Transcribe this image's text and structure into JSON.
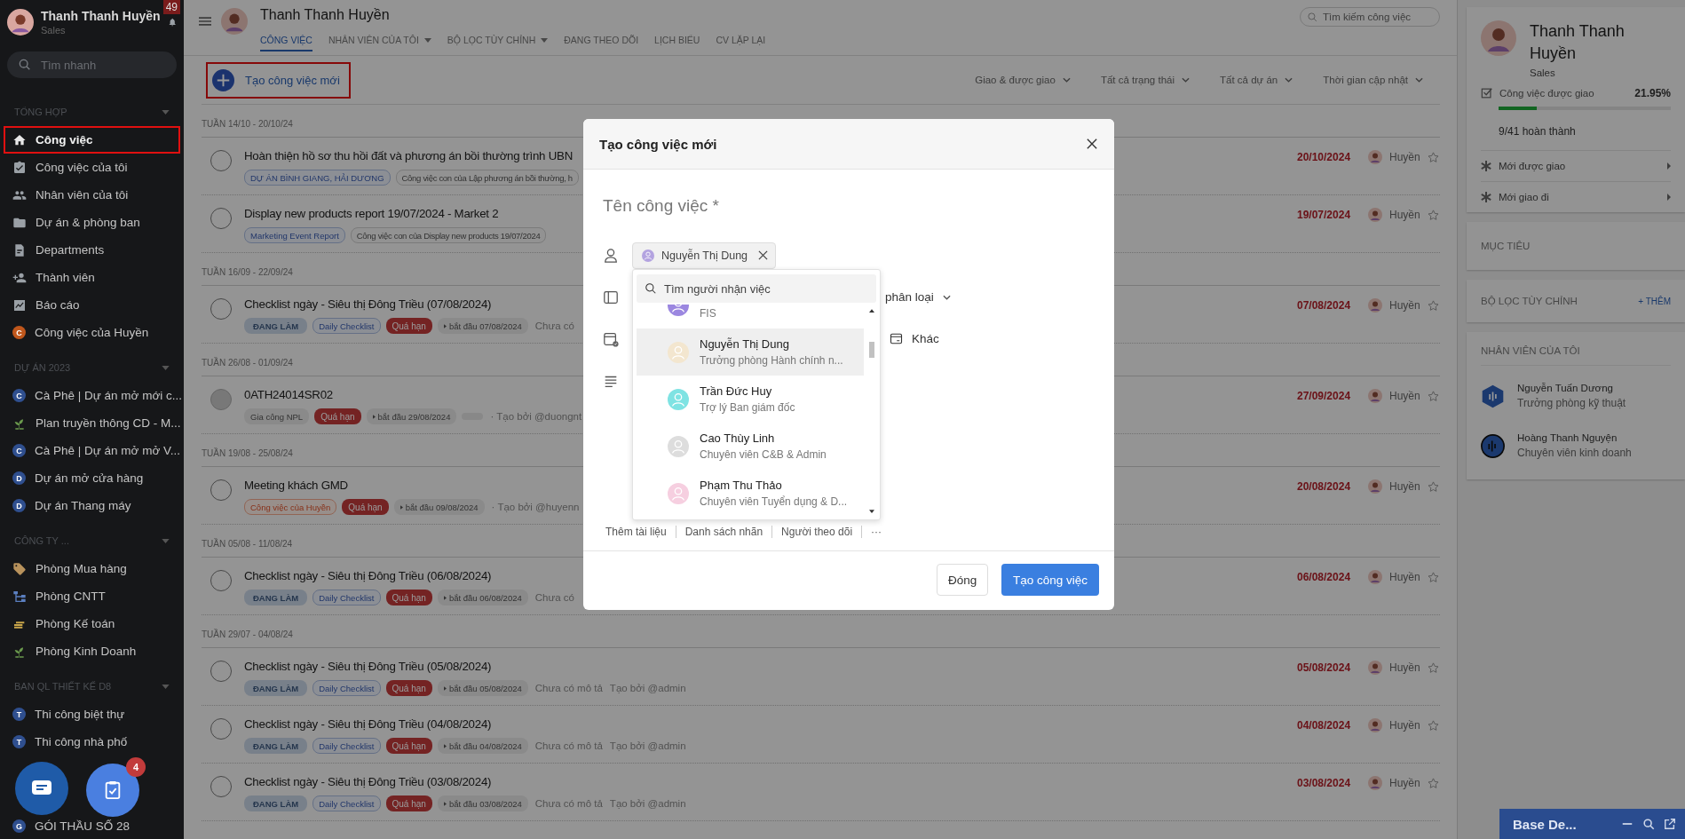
{
  "sidebar": {
    "user": {
      "name": "Thanh Thanh Huyền",
      "role": "Sales",
      "notifications": "49"
    },
    "search": {
      "placeholder": "Tìm nhanh"
    },
    "sections": [
      {
        "title": "TỔNG HỢP",
        "items": [
          {
            "label": "Công việc",
            "selected": true,
            "highlighted": true
          },
          {
            "label": "Công việc của tôi",
            "selected": false,
            "highlighted": false
          },
          {
            "label": "Nhân viên của tôi",
            "selected": false,
            "highlighted": false
          },
          {
            "label": "Dự án & phòng ban",
            "selected": false,
            "highlighted": false
          },
          {
            "label": "Departments",
            "selected": false,
            "highlighted": false
          },
          {
            "label": "Thành viên",
            "selected": false,
            "highlighted": false
          },
          {
            "label": "Báo cáo",
            "selected": false,
            "highlighted": false
          },
          {
            "label": "Công việc của Huyền",
            "selected": false,
            "highlighted": false,
            "letter": "C",
            "color": "#c0571c"
          }
        ]
      },
      {
        "title": "DỰ ÁN 2023",
        "items": [
          {
            "label": "Cà Phê | Dự án mở mới c...",
            "selected": false,
            "highlighted": false,
            "letter": "C",
            "color": "#2f4f8f"
          },
          {
            "label": "Plan truyền thông CD - M...",
            "selected": false,
            "highlighted": false
          },
          {
            "label": "Cà Phê | Dự án mở mở V...",
            "selected": false,
            "highlighted": false,
            "letter": "C",
            "color": "#2f4f8f"
          },
          {
            "label": "Dự án mở cửa hàng",
            "selected": false,
            "highlighted": false,
            "letter": "D",
            "color": "#2f4f8f"
          },
          {
            "label": "Dự án Thang máy",
            "selected": false,
            "highlighted": false,
            "letter": "D",
            "color": "#2f4f8f"
          }
        ]
      },
      {
        "title": "CÔNG TY ...",
        "items": [
          {
            "label": "Phòng Mua hàng",
            "selected": false,
            "highlighted": false
          },
          {
            "label": "Phòng CNTT",
            "selected": false,
            "highlighted": false
          },
          {
            "label": "Phòng Kế toán",
            "selected": false,
            "highlighted": false
          },
          {
            "label": "Phòng Kinh Doanh",
            "selected": false,
            "highlighted": false
          }
        ]
      },
      {
        "title": "BAN QL THIẾT KẾ D8",
        "items": [
          {
            "label": "Thi công biệt thự",
            "selected": false,
            "highlighted": false,
            "letter": "T",
            "color": "#2f4f8f"
          },
          {
            "label": "Thi công nhà phố",
            "selected": false,
            "highlighted": false,
            "letter": "T",
            "color": "#2f4f8f"
          }
        ]
      },
      {
        "items": [
          {
            "label": "GÓI THẦU SỐ 28",
            "selected": false,
            "highlighted": false,
            "letter": "G",
            "color": "#2f4f8f"
          }
        ]
      }
    ]
  },
  "header": {
    "name": "Thanh Thanh Huyền",
    "search": {
      "placeholder": "Tìm kiếm công việc"
    },
    "tabs": [
      {
        "label": "CÔNG VIỆC",
        "selected": true,
        "dropdown": false
      },
      {
        "label": "NHÂN VIÊN CỦA TÔI",
        "selected": false,
        "dropdown": true
      },
      {
        "label": "BỘ LỌC TÙY CHỈNH",
        "selected": false,
        "dropdown": true
      },
      {
        "label": "ĐANG THEO DÕI",
        "selected": false,
        "dropdown": false
      },
      {
        "label": "LỊCH BIỂU",
        "selected": false,
        "dropdown": false
      },
      {
        "label": "CV LẶP LẠI",
        "selected": false,
        "dropdown": false
      }
    ]
  },
  "create_button": {
    "label": "Tạo công việc mới",
    "highlighted": true
  },
  "filters": [
    "Giao & được giao",
    "Tất cả trạng thái",
    "Tất cả dự án",
    "Thời gian cập nhật"
  ],
  "weeks": [
    {
      "title": "TUẦN 14/10 - 20/10/24",
      "tasks": [
        {
          "title": "Hoàn thiện hồ sơ thu hồi đất và phương án bồi thường trình UBN",
          "disabled": false,
          "tags": [
            {
              "kind": "project",
              "text": "DỰ ÁN BÌNH GIANG, HẢI DƯƠNG"
            },
            {
              "kind": "plain",
              "text": "Công việc con của Lập phương án bồi thường, h"
            }
          ],
          "date": "20/10/2024",
          "assignee": "Huyền"
        },
        {
          "title": "Display new products report 19/07/2024 - Market 2",
          "disabled": false,
          "tags": [
            {
              "kind": "project",
              "text": "Marketing Event Report"
            },
            {
              "kind": "plain",
              "text": "Công việc con của Display new products 19/07/2024"
            }
          ],
          "date": "19/07/2024",
          "assignee": "Huyền"
        }
      ]
    },
    {
      "title": "TUẦN 16/09 - 22/09/24",
      "tasks": [
        {
          "title": "Checklist ngày - Siêu thị Đông Triều (07/08/2024)",
          "disabled": false,
          "tags": [
            {
              "kind": "status",
              "text": "ĐANG LÀM"
            },
            {
              "kind": "project",
              "text": "Daily Checklist"
            },
            {
              "kind": "overdue",
              "text": "Quá hạn"
            },
            {
              "kind": "start",
              "text": "bắt đầu 07/08/2024"
            }
          ],
          "note": "Chưa có",
          "date": "07/08/2024",
          "assignee": "Huyền"
        }
      ]
    },
    {
      "title": "TUẦN 26/08 - 01/09/24",
      "tasks": [
        {
          "title": "0ATH24014SR02",
          "disabled": true,
          "tags": [
            {
              "kind": "grey",
              "text": "Gia công NPL"
            },
            {
              "kind": "overdue",
              "text": "Quá hạn"
            },
            {
              "kind": "start",
              "text": "bắt đầu 29/08/2024"
            },
            {
              "kind": "blank"
            }
          ],
          "created_by": "· Tạo bởi @duongnt",
          "date": "27/09/2024",
          "assignee": "Huyền"
        }
      ]
    },
    {
      "title": "TUẦN 19/08 - 25/08/24",
      "tasks": [
        {
          "title": "Meeting khách GMD",
          "disabled": false,
          "tags": [
            {
              "kind": "mine",
              "text": "Công việc của Huyền"
            },
            {
              "kind": "overdue",
              "text": "Quá hạn"
            },
            {
              "kind": "start",
              "text": "bắt đầu 09/08/2024"
            }
          ],
          "created_by": "· Tạo bởi @huyenn",
          "date": "20/08/2024",
          "assignee": "Huyền"
        }
      ]
    },
    {
      "title": "TUẦN 05/08 - 11/08/24",
      "tasks": [
        {
          "title": "Checklist ngày - Siêu thị Đông Triều (06/08/2024)",
          "disabled": false,
          "tags": [
            {
              "kind": "status",
              "text": "ĐANG LÀM"
            },
            {
              "kind": "project",
              "text": "Daily Checklist"
            },
            {
              "kind": "overdue",
              "text": "Quá hạn"
            },
            {
              "kind": "start",
              "text": "bắt đầu 06/08/2024"
            }
          ],
          "note": "Chưa có",
          "date": "06/08/2024",
          "assignee": "Huyền"
        }
      ]
    },
    {
      "title": "TUẦN 29/07 - 04/08/24",
      "tasks": [
        {
          "title": "Checklist ngày - Siêu thị Đông Triều (05/08/2024)",
          "disabled": false,
          "tags": [
            {
              "kind": "status",
              "text": "ĐANG LÀM"
            },
            {
              "kind": "project",
              "text": "Daily Checklist"
            },
            {
              "kind": "overdue",
              "text": "Quá hạn"
            },
            {
              "kind": "start",
              "text": "bắt đầu 05/08/2024"
            }
          ],
          "note": "Chưa có mô tả",
          "created_by": "Tạo bởi @admin",
          "date": "05/08/2024",
          "assignee": "Huyền"
        },
        {
          "title": "Checklist ngày - Siêu thị Đông Triều (04/08/2024)",
          "disabled": false,
          "tags": [
            {
              "kind": "status",
              "text": "ĐANG LÀM"
            },
            {
              "kind": "project",
              "text": "Daily Checklist"
            },
            {
              "kind": "overdue",
              "text": "Quá hạn"
            },
            {
              "kind": "start",
              "text": "bắt đầu 04/08/2024"
            }
          ],
          "note": "Chưa có mô tả",
          "created_by": "Tạo bởi @admin",
          "date": "04/08/2024",
          "assignee": "Huyền"
        },
        {
          "title": "Checklist ngày - Siêu thị Đông Triều (03/08/2024)",
          "disabled": false,
          "tags": [
            {
              "kind": "status",
              "text": "ĐANG LÀM"
            },
            {
              "kind": "project",
              "text": "Daily Checklist"
            },
            {
              "kind": "overdue",
              "text": "Quá hạn"
            },
            {
              "kind": "start",
              "text": "bắt đầu 03/08/2024"
            }
          ],
          "note": "Chưa có mô tả",
          "created_by": "Tạo bởi @admin",
          "date": "03/08/2024",
          "assignee": "Huyền"
        }
      ]
    }
  ],
  "profile": {
    "name": "Thanh Thanh Huyền",
    "role": "Sales",
    "stat_label": "Công việc được giao",
    "percent": "21.95%",
    "level": 0.2195,
    "done": "9/41 hoàn thành",
    "links": [
      "Mới được giao",
      "Mới giao đi"
    ]
  },
  "goals": {
    "title": "MỤC TIÊU"
  },
  "custom_filters": {
    "title": "BỘ LỌC TÙY CHỈNH",
    "action": "+ THÊM"
  },
  "my_staff": {
    "title": "NHÂN VIÊN CỦA TÔI",
    "people": [
      {
        "name": "Nguyễn Tuấn Dương",
        "role": "Trưởng phòng kỹ thuật"
      },
      {
        "name": "Hoàng Thanh Nguyện",
        "role": "Chuyên viên kinh doanh"
      }
    ]
  },
  "modal": {
    "title": "Tạo công việc mới",
    "name_placeholder": "Tên công việc *",
    "assignee": "Nguyễn Thị Dung",
    "category": "phân loại",
    "other": "Khác",
    "toolbar": [
      "Thêm tài liệu",
      "Danh sách nhãn",
      "Người theo dõi",
      "···"
    ],
    "dropdown": {
      "placeholder": "Tìm người nhận việc",
      "people": [
        {
          "role": "FIS",
          "color": "#9b87e0",
          "selected": false
        },
        {
          "name": "Nguyễn Thị Dung",
          "role": "Trưởng phòng Hành chính n...",
          "color": "#f3e6cf",
          "selected": true
        },
        {
          "name": "Trần Đức Huy",
          "role": "Trợ lý Ban giám đốc",
          "color": "#7fe3e3",
          "selected": false
        },
        {
          "name": "Cao Thùy Linh",
          "role": "Chuyên viên C&B & Admin",
          "color": "#dddddd",
          "selected": false
        },
        {
          "name": "Phạm Thu Thảo",
          "role": "Chuyên viên Tuyển dụng & D...",
          "color": "#f6cfe0",
          "selected": false
        }
      ]
    },
    "buttons": [
      {
        "label": "Đóng",
        "kind": "secondary"
      },
      {
        "label": "Tạo công việc",
        "kind": "primary"
      }
    ]
  },
  "chat_badge": "4",
  "chat_widget": {
    "title": "Base De..."
  }
}
